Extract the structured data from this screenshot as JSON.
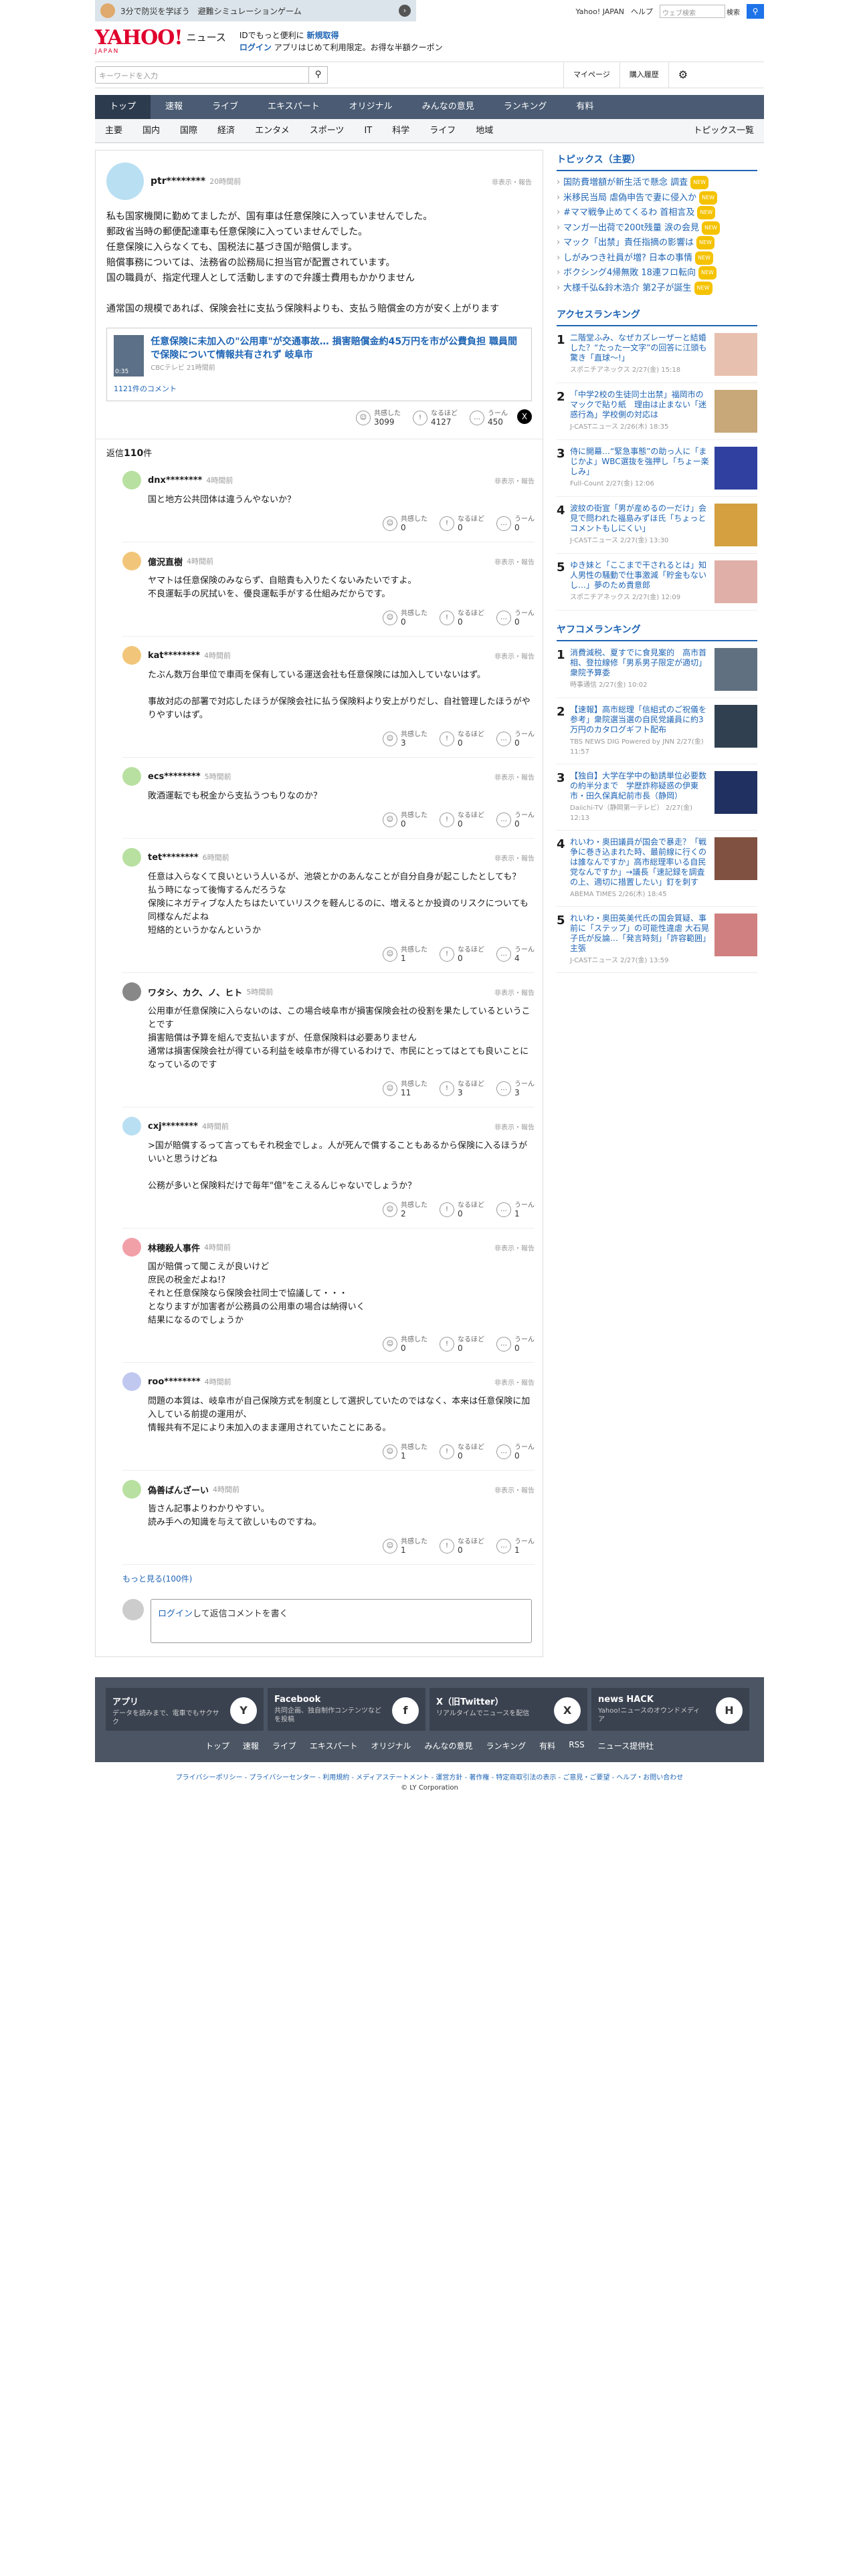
{
  "ad": {
    "text": "3分で防災を学ぼう　避難シミュレーションゲーム"
  },
  "toplinks": {
    "yahoo": "Yahoo! JAPAN",
    "help": "ヘルプ",
    "search_placeholder": "ウェブ検索",
    "search_btn": "検索"
  },
  "brand": {
    "logo": "YAHOO!",
    "logo_sub": "JAPAN",
    "news": "ニュース",
    "promo1": "IDでもっと便利に",
    "promo1b": "新規取得",
    "promo2a": "ログイン",
    "promo2": "アプリはじめて利用限定。お得な半額クーポン"
  },
  "search": {
    "placeholder": "キーワードを入力",
    "mypage": "マイページ",
    "history": "購入履歴"
  },
  "nav1": [
    "トップ",
    "速報",
    "ライブ",
    "エキスパート",
    "オリジナル",
    "みんなの意見",
    "ランキング",
    "有料"
  ],
  "nav2": [
    "主要",
    "国内",
    "国際",
    "経済",
    "エンタメ",
    "スポーツ",
    "IT",
    "科学",
    "ライフ",
    "地域"
  ],
  "nav2_last": "トピックス一覧",
  "post": {
    "user": "ptr********",
    "time": "20時間前",
    "report": "非表示・報告",
    "text": "私も国家機関に勤めてましたが、国有車は任意保険に入っていませんでした。\n郵政省当時の郵便配達車も任意保険に入っていませんでした。\n任意保険に入らなくても、国税法に基づき国が賠償します。\n賠償事務については、法務省の訟務局に担当官が配置されています。\n国の職員が、指定代理人として活動しますので弁護士費用もかかりません\n\n通常国の規模であれば、保険会社に支払う保険料よりも、支払う賠償金の方が安く上がります",
    "card_title": "任意保険に未加入の\"公用車\"が交通事故… 損害賠償金約45万円を市が公費負担 職員間で保険について情報共有されず 岐阜市",
    "card_src": "CBCテレビ 21時間前",
    "card_time": "0:35",
    "card_comments": "1121件のコメント",
    "r1": "共感した",
    "r1v": "3099",
    "r2": "なるほど",
    "r2v": "4127",
    "r3": "うーん",
    "r3v": "450"
  },
  "reply_count": {
    "label": "返信",
    "value": "110",
    "suffix": "件"
  },
  "replies": [
    {
      "user": "dnx********",
      "time": "4時間前",
      "text": "国と地方公共団体は違うんやないか？",
      "a": "0",
      "b": "0",
      "c": "0"
    },
    {
      "user": "億況直樹",
      "time": "4時間前",
      "text": "ヤマトは任意保険のみならず、自賠責も入りたくないみたいですよ。\n不良運転手の尻拭いを、優良運転手がする仕組みだからです。",
      "a": "0",
      "b": "0",
      "c": "0"
    },
    {
      "user": "kat********",
      "time": "4時間前",
      "text": "たぶん数万台単位で車両を保有している運送会社も任意保険には加入していないはず。\n\n事故対応の部署で対応したほうが保険会社に払う保険料より安上がりだし、自社管理したほうがやりやすいはず。",
      "a": "3",
      "b": "0",
      "c": "0"
    },
    {
      "user": "ecs********",
      "time": "5時間前",
      "text": "敗酒運転でも税金から支払うつもりなのか？",
      "a": "0",
      "b": "0",
      "c": "0"
    },
    {
      "user": "tet********",
      "time": "6時間前",
      "text": "任意は入らなくて良いという人いるが、池袋とかのあんなことが自分自身が起こしたとしても？\n払う時になって後悔するんだろうな\n保険にネガティブな人たちはたいていリスクを軽んじるのに、増えるとか投資のリスクについても同様なんだよね\n短絡的というかなんというか",
      "a": "1",
      "b": "0",
      "c": "4"
    },
    {
      "user": "ワタシ、カク、ノ、ヒト",
      "time": "5時間前",
      "text": "公用車が任意保険に入らないのは、この場合岐阜市が損害保険会社の役割を果たしているということです\n損害賠償は予算を組んで支払いますが、任意保険料は必要ありません\n通常は損害保険会社が得ている利益を岐阜市が得ているわけで、市民にとってはとても良いことになっているのです",
      "a": "11",
      "b": "3",
      "c": "3"
    },
    {
      "user": "cxj********",
      "time": "4時間前",
      "text": ">国が賠償するって言ってもそれ税金でしょ。人が死んで償することもあるから保険に入るほうがいいと思うけどね\n\n公務が多いと保険料だけで毎年\"億\"をこえるんじゃないでしょうか？",
      "a": "2",
      "b": "0",
      "c": "1"
    },
    {
      "user": "林穂殺人事件",
      "time": "4時間前",
      "text": "国が賠償って聞こえが良いけど\n庶民の税金だよね!?\nそれと任意保険なら保険会社同士で協議して・・・\nとなりますが加害者が公務員の公用車の場合は納得いく\n結果になるのでしょうか",
      "a": "0",
      "b": "0",
      "c": "0"
    },
    {
      "user": "roo********",
      "time": "4時間前",
      "text": "問題の本質は、岐阜市が自己保険方式を制度として選択していたのではなく、本来は任意保険に加入している前提の運用が、\n情報共有不足により未加入のまま運用されていたことにある。",
      "a": "1",
      "b": "0",
      "c": "0"
    },
    {
      "user": "偽善ばんざーい",
      "time": "4時間前",
      "text": "皆さん記事よりわかりやすい。\n読み手への知識を与えて欲しいものですね。",
      "a": "1",
      "b": "0",
      "c": "1"
    }
  ],
  "reply_labels": {
    "a": "共感した",
    "b": "なるほど",
    "c": "うーん",
    "report": "非表示・報告"
  },
  "more": "もっと見る(100件)",
  "compose": {
    "login": "ログイン",
    "text": "して返信コメントを書く"
  },
  "topics": {
    "title": "トピックス（主要）",
    "items": [
      "国防費増額が新生活で懸念 調査",
      "米移民当局 虐偽申告で妻に侵入か",
      "#ママ戦争止めてくるわ 首相言及",
      "マンガ一出荷で200t残量 涙の会見",
      "マック「出禁」責任指摘の影響は",
      "しがみつき社員が増? 日本の事情",
      "ボクシング4帰無敗 18連フロ転向",
      "大様千弘&鈴木浩介 第2子が誕生"
    ],
    "new": "NEW"
  },
  "access": {
    "title": "アクセスランキング",
    "items": [
      {
        "t": "二階堂ふみ、なぜカズレーザーと結婚した？“たった一文字”の回答に江頭も驚き「直球〜!」",
        "s": "スポニチアネックス 2/27(金) 15:18"
      },
      {
        "t": "「中学2校の生徒同士出禁」福岡市のマックで貼り紙　理由は止まない「迷惑行為」学校側の対応は",
        "s": "J-CASTニュース 2/26(木) 18:35"
      },
      {
        "t": "侍に開幕…“緊急事態”の助っ人に「まじかよ」WBC選抜を強押し「ちょー楽しみ」",
        "s": "Full-Count 2/27(金) 12:06"
      },
      {
        "t": "波紋の街宣「男が産めるの一だけ」会見で問われた福島みずほ氏「ちょっとコメントもしにくい」",
        "s": "J-CASTニュース 2/27(金) 13:30"
      },
      {
        "t": "ゆき妹と「ここまで干されるとは」知人男性の騒動で仕事激減「貯金もないし…」夢のため貴意郎",
        "s": "スポニチアネックス 2/27(金) 12:09"
      }
    ]
  },
  "yafuko": {
    "title": "ヤフコメランキング",
    "items": [
      {
        "t": "消費減税、夏すでに食見案的　高市首相、登拉線修「男系男子限定が適切」衆院予算委",
        "s": "時事通信 2/27(金) 10:02"
      },
      {
        "t": "【速報】高市総理「信組式のご祝儀を参考」衆院選当選の自民党議員に約3万円のカタログギフト配布",
        "s": "TBS NEWS DIG Powered by JNN 2/27(金) 11:57"
      },
      {
        "t": "【独自】大学在学中の勧誘単位必要数の約半分まで　学歴詐称疑惑の伊東市・田久保真紀前市長（静岡）",
        "s": "Daiichi-TV（静岡第一テレビ） 2/27(金) 12:13"
      },
      {
        "t": "れいわ・奥田議員が国会で暴走？「戦争に巻き込まれた時、最前線に行くのは誰なんですか」高市総理率いる自民党なんですか」→議長「速記録を調査の上、適切に措置したい」釘を刺す",
        "s": "ABEMA TIMES 2/26(木) 18:45"
      },
      {
        "t": "れいわ・奥田英美代氏の国会質疑、事前に「ステップ」の可能性違虐 大石晃子氏が反論…「発言時刻」「許容範囲」主張",
        "s": "J-CASTニュース 2/27(金) 13:59"
      }
    ]
  },
  "footer": {
    "apps": [
      {
        "n": "アプリ",
        "d": "データを読みまで、電車でもサクサク",
        "i": "Y"
      },
      {
        "n": "Facebook",
        "d": "共同企画、独自制作コンテンツなどを投稿",
        "i": "f"
      },
      {
        "n": "X（旧Twitter）",
        "d": "リアルタイムでニュースを配信",
        "i": "X"
      },
      {
        "n": "news HACK",
        "d": "Yahoo!ニュースのオウンドメディア",
        "i": "H"
      }
    ],
    "links": [
      "トップ",
      "速報",
      "ライブ",
      "エキスパート",
      "オリジナル",
      "みんなの意見",
      "ランキング",
      "有料",
      "RSS",
      "ニュース提供社"
    ],
    "legal": "プライバシーポリシー - プライバシーセンター - 利用規約 - メディアステートメント - 運営方針 - 著作権 - 特定商取引法の表示 - ご意見・ご要望 - ヘルプ・お問い合わせ",
    "copy": "© LY Corporation"
  },
  "colors": {
    "accent": "#1e64b4",
    "nav": "#4a5b73",
    "logo": "#e0002d"
  }
}
